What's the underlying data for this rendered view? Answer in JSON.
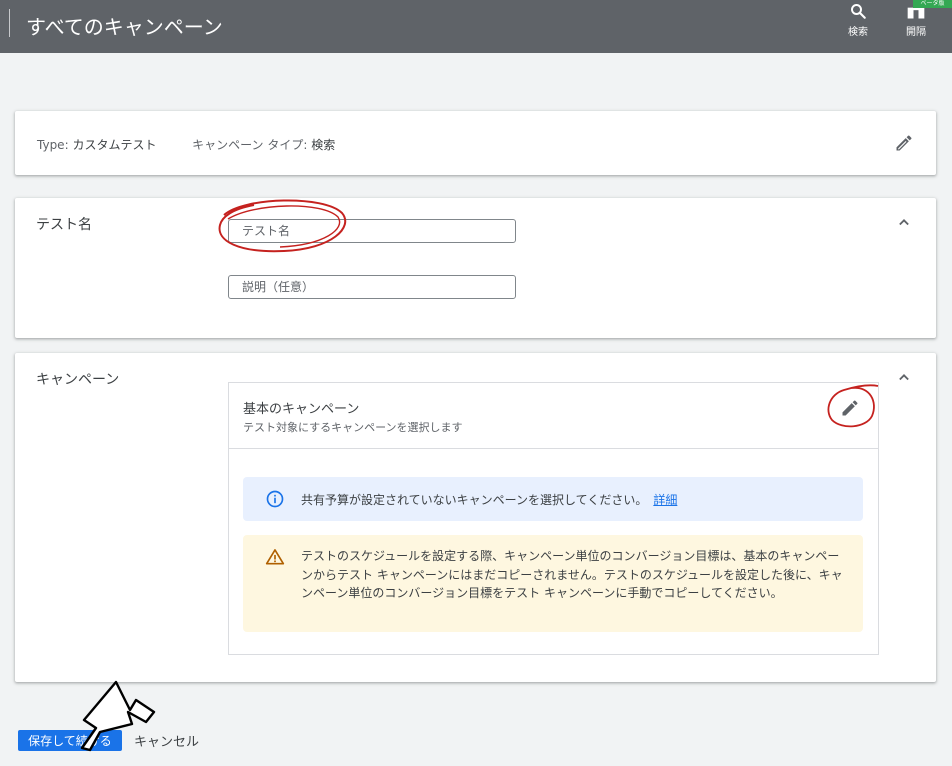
{
  "header": {
    "title": "すべてのキャンペーン",
    "tools": [
      {
        "label": "検索",
        "icon": "search-icon"
      },
      {
        "label": "開隔",
        "icon": "panel-icon"
      }
    ],
    "beta_badge": "ベータ版"
  },
  "type_card": {
    "type_label": "Type:",
    "type_value": "カスタムテスト",
    "campaign_type_label": "キャンペーン タイプ:",
    "campaign_type_value": "検索"
  },
  "test_name_section": {
    "label": "テスト名",
    "name_placeholder": "テスト名",
    "description_placeholder": "説明（任意）"
  },
  "campaign_section": {
    "label": "キャンペーン",
    "base_campaign_title": "基本のキャンペーン",
    "base_campaign_subtitle": "テスト対象にするキャンペーンを選択します",
    "info_message": "共有予算が設定されていないキャンペーンを選択してください。",
    "info_link": "詳細",
    "warning_message": "テストのスケジュールを設定する際、キャンペーン単位のコンバージョン目標は、基本のキャンペーンからテスト キャンペーンにはまだコピーされません。テストのスケジュールを設定した後に、キャンペーン単位のコンバージョン目標をテスト キャンペーンに手動でコピーしてください。"
  },
  "footer": {
    "save_label": "保存して続ける",
    "cancel_label": "キャンセル"
  },
  "colors": {
    "topbar": "#5f6368",
    "primary": "#1a73e8",
    "info_bg": "#e8f0fe",
    "warning_bg": "#fef7e0",
    "annotation": "#c5221f"
  }
}
